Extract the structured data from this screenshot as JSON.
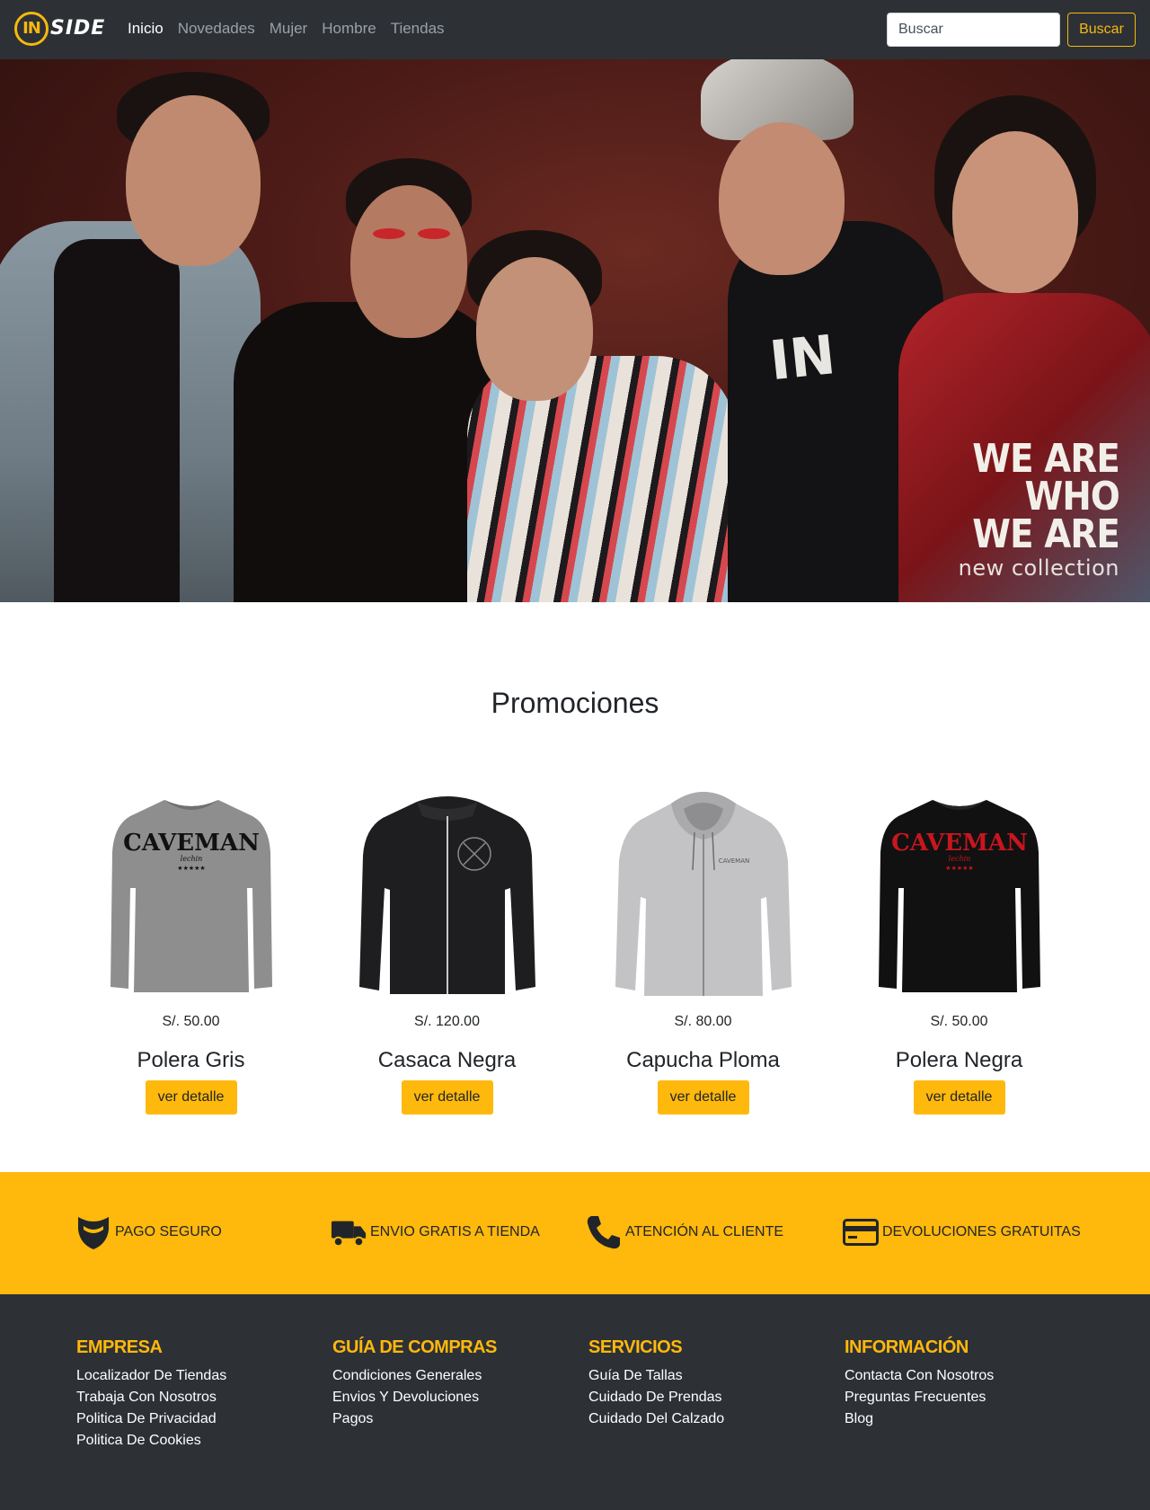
{
  "brand": {
    "logo_text": "INSIDE",
    "colors": {
      "accent": "#ffb80c",
      "nav_bg": "#2d3136",
      "footer_bg": "#2d3136"
    }
  },
  "nav": {
    "items": [
      {
        "label": "Inicio",
        "active": true
      },
      {
        "label": "Novedades",
        "active": false
      },
      {
        "label": "Mujer",
        "active": false
      },
      {
        "label": "Hombre",
        "active": false
      },
      {
        "label": "Tiendas",
        "active": false
      }
    ],
    "search_placeholder": "Buscar",
    "search_button": "Buscar"
  },
  "hero": {
    "line1": "WE ARE",
    "line2": "WHO",
    "line3": "WE ARE",
    "subtitle": "new collection"
  },
  "promos": {
    "title": "Promociones",
    "products": [
      {
        "price": "S/. 50.00",
        "name": "Polera Gris",
        "button": "ver detalle",
        "image": "grey-sweatshirt-caveman"
      },
      {
        "price": "S/. 120.00",
        "name": "Casaca Negra",
        "button": "ver detalle",
        "image": "black-zip-jacket"
      },
      {
        "price": "S/. 80.00",
        "name": "Capucha Ploma",
        "button": "ver detalle",
        "image": "grey-zip-hoodie"
      },
      {
        "price": "S/. 50.00",
        "name": "Polera Negra",
        "button": "ver detalle",
        "image": "black-sweatshirt-caveman-red"
      }
    ]
  },
  "features": [
    {
      "icon": "shield-icon",
      "label": "PAGO SEGURO"
    },
    {
      "icon": "truck-icon",
      "label": "ENVIO GRATIS A TIENDA"
    },
    {
      "icon": "phone-icon",
      "label": "ATENCIÓN AL CLIENTE"
    },
    {
      "icon": "credit-card-icon",
      "label": "DEVOLUCIONES GRATUITAS"
    }
  ],
  "footer": {
    "columns": [
      {
        "heading": "EMPRESA",
        "links": [
          "Localizador De Tiendas",
          "Trabaja Con Nosotros",
          "Politica De Privacidad",
          "Politica De Cookies"
        ]
      },
      {
        "heading": "GUÍA DE COMPRAS",
        "links": [
          "Condiciones Generales",
          "Envios Y Devoluciones",
          "Pagos"
        ]
      },
      {
        "heading": "SERVICIOS",
        "links": [
          "Guía De Tallas",
          "Cuidado De Prendas",
          "Cuidado Del Calzado"
        ]
      },
      {
        "heading": "INFORMACIÓN",
        "links": [
          "Contacta Con Nosotros",
          "Preguntas Frecuentes",
          "Blog"
        ]
      }
    ]
  }
}
